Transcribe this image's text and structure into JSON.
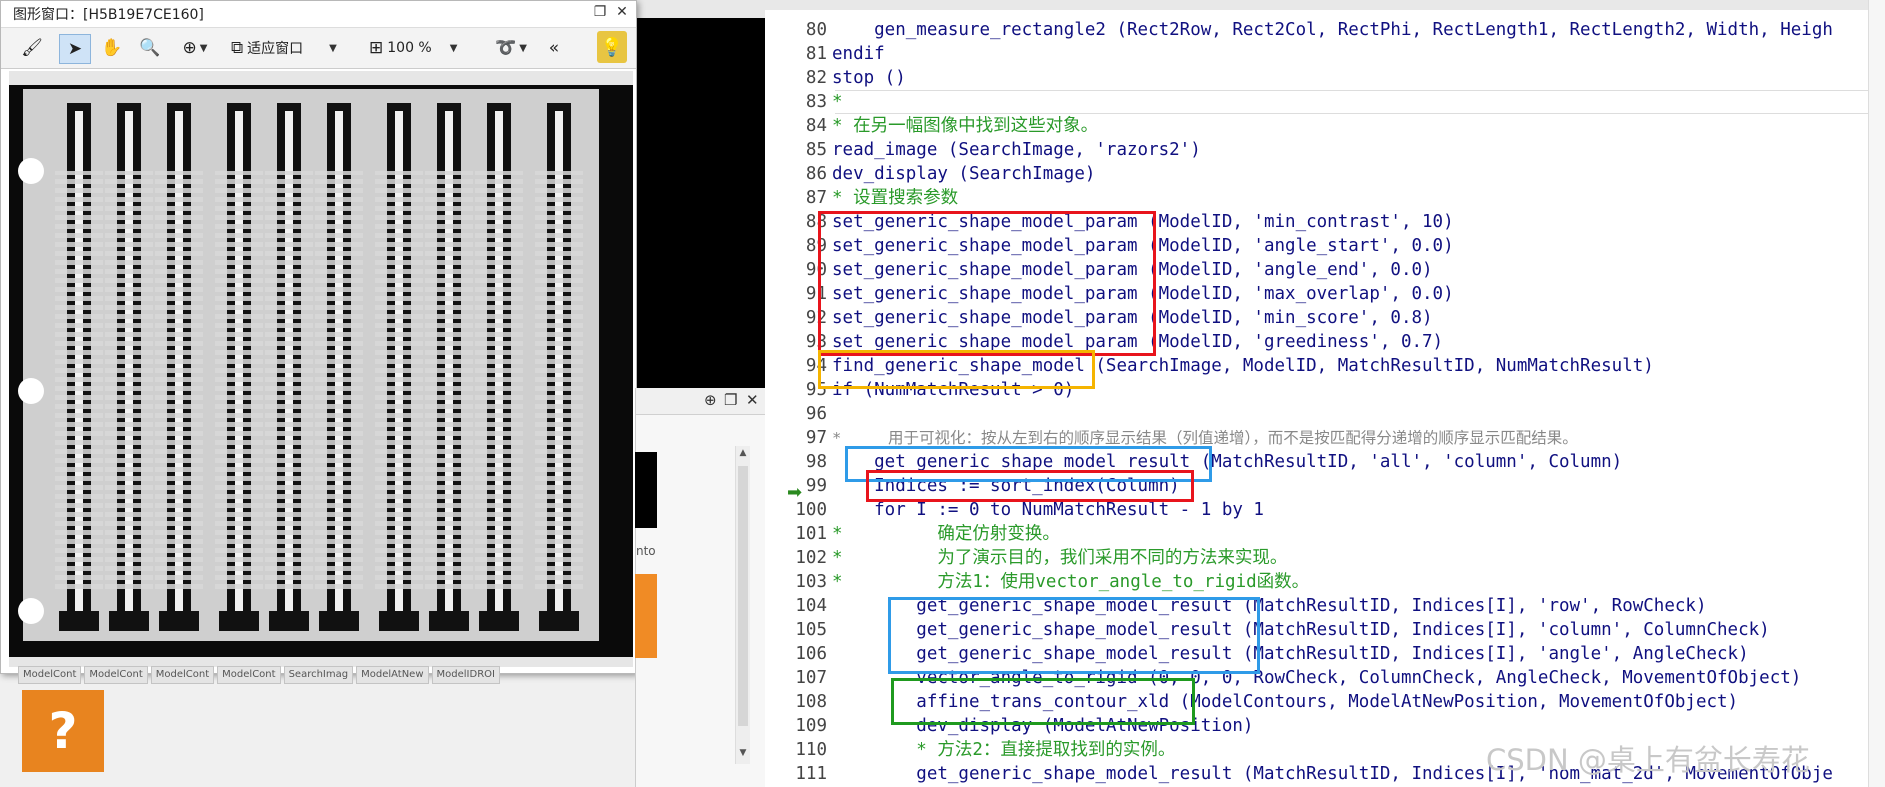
{
  "graphics_window": {
    "title": "图形窗口：[H5B19E7CE160]",
    "fit_label": "适应窗口",
    "zoom_label": "100 %",
    "more_label": "«"
  },
  "left_panel": {
    "tab_labels": [
      "ModelCont",
      "ModelCont",
      "ModelCont",
      "ModelCont",
      "SearchImag",
      "ModelAtNew",
      "ModelIDROI"
    ],
    "side_text": "nto",
    "question_mark": "?"
  },
  "editor": {
    "lines": [
      {
        "n": "80",
        "text": "    gen_measure_rectangle2 (Rect2Row, Rect2Col, RectPhi, RectLength1, RectLength2, Width, Heigh",
        "kind": "code"
      },
      {
        "n": "81",
        "text": "endif",
        "kind": "code"
      },
      {
        "n": "82",
        "text": "stop ()",
        "kind": "code"
      },
      {
        "n": "83",
        "text": "*",
        "kind": "comment"
      },
      {
        "n": "84",
        "text": "* 在另一幅图像中找到这些对象。",
        "kind": "comment"
      },
      {
        "n": "85",
        "text": "read_image (SearchImage, 'razors2')",
        "kind": "code"
      },
      {
        "n": "86",
        "text": "dev_display (SearchImage)",
        "kind": "code"
      },
      {
        "n": "87",
        "text": "* 设置搜索参数",
        "kind": "comment"
      },
      {
        "n": "88",
        "text": "set_generic_shape_model_param (ModelID, 'min_contrast', 10)",
        "kind": "code"
      },
      {
        "n": "89",
        "text": "set_generic_shape_model_param (ModelID, 'angle_start', 0.0)",
        "kind": "code"
      },
      {
        "n": "90",
        "text": "set_generic_shape_model_param (ModelID, 'angle_end', 0.0)",
        "kind": "code"
      },
      {
        "n": "91",
        "text": "set_generic_shape_model_param (ModelID, 'max_overlap', 0.0)",
        "kind": "code"
      },
      {
        "n": "92",
        "text": "set_generic_shape_model_param (ModelID, 'min_score', 0.8)",
        "kind": "code"
      },
      {
        "n": "93",
        "text": "set_generic_shape_model_param (ModelID, 'greediness', 0.7)",
        "kind": "code"
      },
      {
        "n": "94",
        "text": "find_generic_shape_model (SearchImage, ModelID, MatchResultID, NumMatchResult)",
        "kind": "code"
      },
      {
        "n": "95",
        "text": "if (NumMatchResult > 0)",
        "kind": "code"
      },
      {
        "n": "96",
        "text": "",
        "kind": "code"
      },
      {
        "n": "97",
        "text": "*     用于可视化：按从左到右的顺序显示结果（列值递增），而不是按匹配得分递增的顺序显示匹配结果。",
        "kind": "comment_gray"
      },
      {
        "n": "98",
        "text": "    get_generic_shape_model_result (MatchResultID, 'all', 'column', Column)",
        "kind": "code"
      },
      {
        "n": "99",
        "text": "    Indices := sort_index(Column)",
        "kind": "code"
      },
      {
        "n": "100",
        "text": "    for I := 0 to NumMatchResult - 1 by 1",
        "kind": "code"
      },
      {
        "n": "101",
        "text": "*         确定仿射变换。",
        "kind": "comment"
      },
      {
        "n": "102",
        "text": "*         为了演示目的，我们采用不同的方法来实现。",
        "kind": "comment"
      },
      {
        "n": "103",
        "text": "*         方法1：使用vector_angle_to_rigid函数。",
        "kind": "comment"
      },
      {
        "n": "104",
        "text": "        get_generic_shape_model_result (MatchResultID, Indices[I], 'row', RowCheck)",
        "kind": "code"
      },
      {
        "n": "105",
        "text": "        get_generic_shape_model_result (MatchResultID, Indices[I], 'column', ColumnCheck)",
        "kind": "code"
      },
      {
        "n": "106",
        "text": "        get_generic_shape_model_result (MatchResultID, Indices[I], 'angle', AngleCheck)",
        "kind": "code"
      },
      {
        "n": "107",
        "text": "        vector_angle_to_rigid (0, 0, 0, RowCheck, ColumnCheck, AngleCheck, MovementOfObject)",
        "kind": "code"
      },
      {
        "n": "108",
        "text": "        affine_trans_contour_xld (ModelContours, ModelAtNewPosition, MovementOfObject)",
        "kind": "code"
      },
      {
        "n": "109",
        "text": "        dev_display (ModelAtNewPosition)",
        "kind": "code"
      },
      {
        "n": "110",
        "text": "        * 方法2：直接提取找到的实例。",
        "kind": "comment"
      },
      {
        "n": "111",
        "text": "        get_generic_shape_model_result (MatchResultID, Indices[I], 'hom_mat_2d', MovementOfObje",
        "kind": "code"
      }
    ]
  },
  "annotation_colors": {
    "red": "#e8141c",
    "orange": "#f5b400",
    "blue": "#2f9be8",
    "green": "#1f9a1f"
  },
  "watermark": "CSDN @桌上有盆长寿花"
}
